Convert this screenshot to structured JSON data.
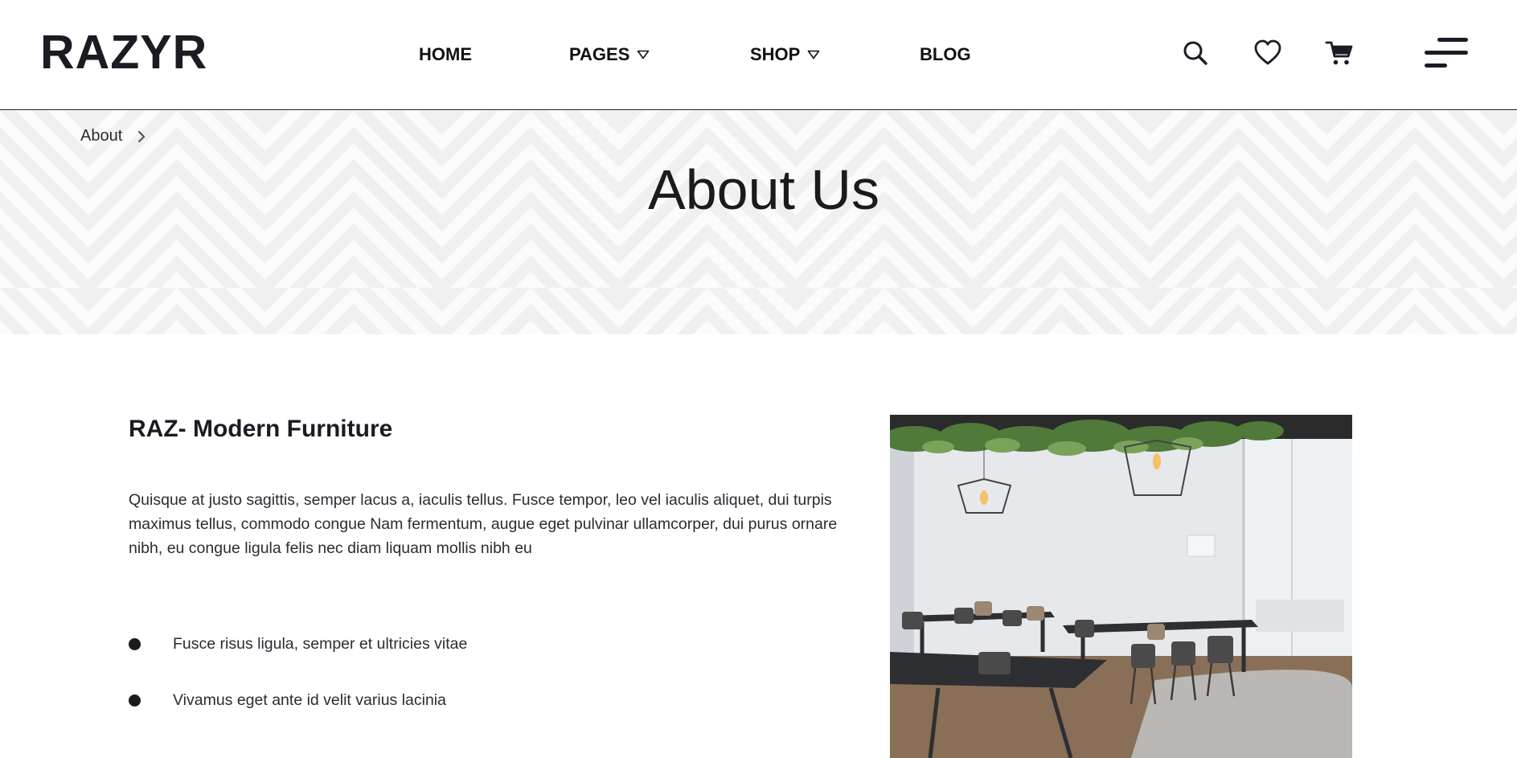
{
  "header": {
    "logo": "RAZYR",
    "nav": [
      {
        "label": "HOME",
        "has_dropdown": false
      },
      {
        "label": "PAGES",
        "has_dropdown": true
      },
      {
        "label": "SHOP",
        "has_dropdown": true
      },
      {
        "label": "BLOG",
        "has_dropdown": false
      }
    ],
    "icons": [
      "search-icon",
      "heart-icon",
      "cart-icon",
      "menu-icon"
    ]
  },
  "hero": {
    "breadcrumb": "About",
    "title": "About Us"
  },
  "content": {
    "heading": "RAZ- Modern Furniture",
    "paragraph": "Quisque at justo sagittis, semper lacus a, iaculis tellus. Fusce tempor, leo vel iaculis aliquet, dui turpis maximus tellus, commodo congue Nam fermentum, augue eget pulvinar ullamcorper, dui purus ornare nibh, eu congue ligula felis nec diam liquam mollis nibh eu",
    "bullets": [
      "Fusce risus ligula, semper et ultricies vitae",
      "Vivamus eget ante id velit varius lacinia"
    ]
  },
  "colors": {
    "text_dark": "#1b1b24",
    "hero_background": "#f0f0f0",
    "hero_pattern": "#fafafa"
  }
}
